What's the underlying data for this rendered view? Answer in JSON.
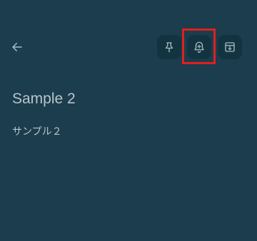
{
  "toolbar": {
    "back_icon": "arrow-left-icon",
    "pin_icon": "pin-icon",
    "reminder_icon": "bell-plus-icon",
    "archive_icon": "archive-icon"
  },
  "note": {
    "title": "Sample 2",
    "body": "サンプル２"
  },
  "colors": {
    "background": "#1b3d4d",
    "button_background": "#123441",
    "icon": "#aab9c0",
    "text": "#b8c5cb",
    "highlight": "#e0201e"
  }
}
